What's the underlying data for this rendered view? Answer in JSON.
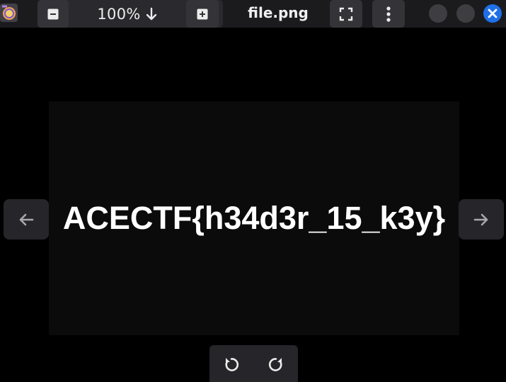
{
  "header": {
    "title": "file.png",
    "zoom": "100%",
    "icons": {
      "app": "image-viewer-app-icon",
      "zoom_out": "minus-box-icon",
      "zoom_menu": "arrow-down-icon",
      "zoom_in": "plus-box-icon",
      "fullscreen": "fullscreen-corners-icon",
      "menu": "vertical-ellipsis-icon",
      "minimize": "circle-icon",
      "maximize": "circle-icon",
      "close": "close-x-icon"
    }
  },
  "image": {
    "text": "ACECTF{h34d3r_15_k3y}"
  },
  "navigation": {
    "previous_icon": "arrow-left-icon",
    "next_icon": "arrow-right-icon"
  },
  "rotate": {
    "left_icon": "rotate-counterclockwise-icon",
    "right_icon": "rotate-clockwise-icon"
  },
  "colors": {
    "background": "#000000",
    "headerbar": "#1b1b1e",
    "button": "#343438",
    "close_accent": "#1f6fe8",
    "image_panel": "#0b0b0c"
  }
}
